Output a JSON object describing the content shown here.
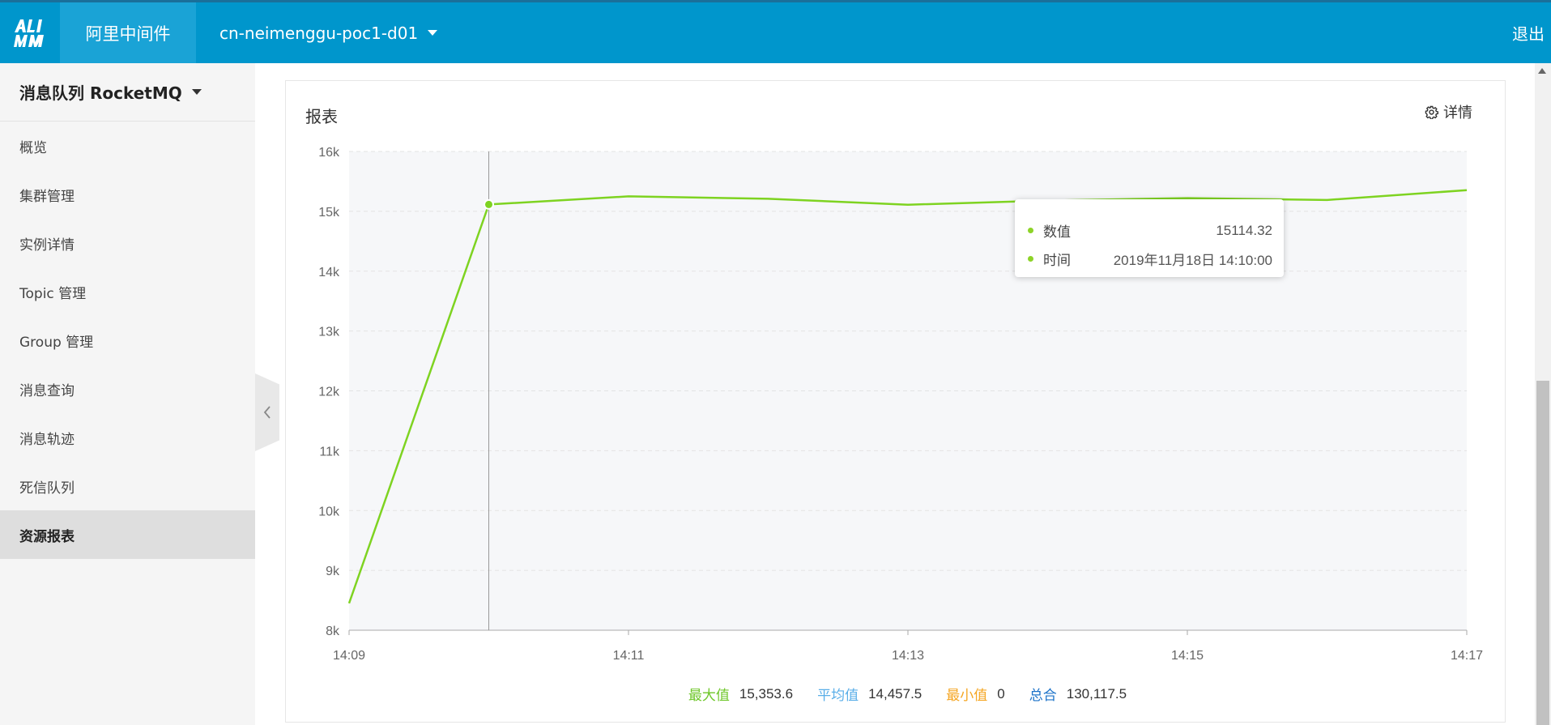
{
  "header": {
    "brand": "阿里中间件",
    "region": "cn-neimenggu-poc1-d01",
    "logout": "退出"
  },
  "sidebar": {
    "product": "消息队列 RocketMQ",
    "items": [
      {
        "label": "概览",
        "active": false
      },
      {
        "label": "集群管理",
        "active": false
      },
      {
        "label": "实例详情",
        "active": false
      },
      {
        "label": "Topic 管理",
        "active": false
      },
      {
        "label": "Group 管理",
        "active": false
      },
      {
        "label": "消息查询",
        "active": false
      },
      {
        "label": "消息轨迹",
        "active": false
      },
      {
        "label": "死信队列",
        "active": false
      },
      {
        "label": "资源报表",
        "active": true
      }
    ]
  },
  "card": {
    "title": "报表",
    "detail_label": "详情"
  },
  "tooltip": {
    "value_label": "数值",
    "value": "15114.32",
    "time_label": "时间",
    "time": "2019年11月18日 14:10:00"
  },
  "summary": {
    "max_label": "最大值",
    "max_value": "15,353.6",
    "avg_label": "平均值",
    "avg_value": "14,457.5",
    "min_label": "最小值",
    "min_value": "0",
    "sum_label": "总合",
    "sum_value": "130,117.5"
  },
  "colors": {
    "line": "#7ed321",
    "max": "#6fc72a",
    "avg": "#5aaee8",
    "min": "#f5a623",
    "sum": "#1d73c9"
  },
  "chart_data": {
    "type": "line",
    "x": [
      "14:09",
      "14:10",
      "14:11",
      "14:12",
      "14:13",
      "14:14",
      "14:15",
      "14:16",
      "14:17"
    ],
    "values": [
      8450,
      15114.32,
      15250,
      15210,
      15110,
      15180,
      15220,
      15190,
      15353.6
    ],
    "x_ticks": [
      "14:09",
      "14:11",
      "14:13",
      "14:15",
      "14:17"
    ],
    "y_ticks": [
      "8k",
      "9k",
      "10k",
      "11k",
      "12k",
      "13k",
      "14k",
      "15k",
      "16k"
    ],
    "ylim": [
      8000,
      16000
    ],
    "highlight_index": 1,
    "grid": true
  }
}
